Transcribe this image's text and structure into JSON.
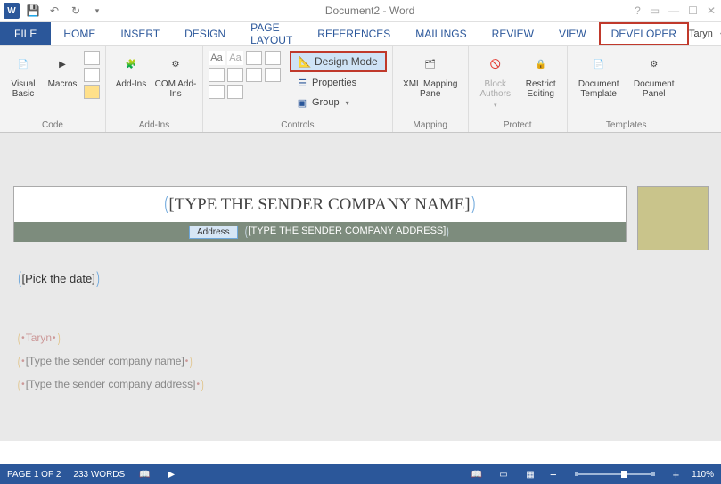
{
  "titlebar": {
    "title": "Document2 - Word"
  },
  "tabs": {
    "file": "FILE",
    "items": [
      "HOME",
      "INSERT",
      "DESIGN",
      "PAGE LAYOUT",
      "REFERENCES",
      "MAILINGS",
      "REVIEW",
      "VIEW",
      "DEVELOPER"
    ],
    "active": "DEVELOPER",
    "user": "Taryn"
  },
  "ribbon": {
    "code": {
      "label": "Code",
      "visual_basic": "Visual Basic",
      "macros": "Macros"
    },
    "addins": {
      "label": "Add-Ins",
      "addins": "Add-Ins",
      "com": "COM Add-Ins"
    },
    "controls": {
      "label": "Controls",
      "design_mode": "Design Mode",
      "properties": "Properties",
      "group": "Group"
    },
    "mapping": {
      "label": "Mapping",
      "xml_pane": "XML Mapping Pane"
    },
    "protect": {
      "label": "Protect",
      "block_authors": "Block Authors",
      "restrict": "Restrict Editing"
    },
    "templates": {
      "label": "Templates",
      "template": "Document Template",
      "panel": "Document Panel"
    }
  },
  "doc": {
    "title_cc": "[TYPE THE SENDER COMPANY NAME]",
    "address_tag": "Address",
    "address_cc": "[TYPE THE SENDER COMPANY ADDRESS]",
    "date_cc": "[Pick the date]",
    "name_cc": "Taryn",
    "company_cc": "[Type the sender company name]",
    "addr2_cc": "[Type the sender company address]"
  },
  "status": {
    "page": "PAGE 1 OF 2",
    "words": "233 WORDS",
    "zoom": "110%"
  }
}
